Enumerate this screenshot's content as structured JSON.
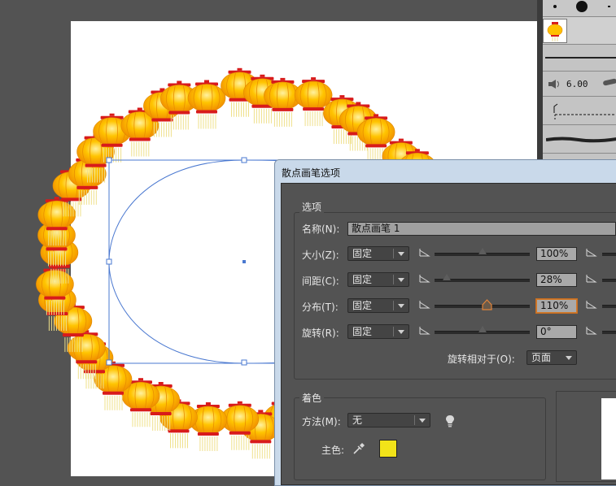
{
  "dialog": {
    "title": "散点画笔选项",
    "options_group": {
      "title": "选项",
      "name_label": "名称(N):",
      "name_value": "散点画笔 1",
      "rows": [
        {
          "label": "大小(Z):",
          "mode": "固定",
          "value": "100%",
          "slider_fraction": 0.5
        },
        {
          "label": "间距(C):",
          "mode": "固定",
          "value": "28%",
          "slider_fraction": 0.12
        },
        {
          "label": "分布(T):",
          "mode": "固定",
          "value": "110%",
          "slider_fraction": 0.55
        },
        {
          "label": "旋转(R):",
          "mode": "固定",
          "value": "0°",
          "slider_fraction": 0.5
        }
      ],
      "rotation_relative_label": "旋转相对于(O):",
      "rotation_relative_value": "页面"
    },
    "colorization_group": {
      "title": "着色",
      "method_label": "方法(M):",
      "method_value": "无",
      "key_color_label": "主色:",
      "key_color": "#f2e319"
    }
  },
  "brush_panel": {
    "size_readout": "6.00"
  },
  "colors": {
    "workspace": "#535353",
    "selection": "#4a78d0",
    "lantern_body": "#ffc000",
    "lantern_cap": "#e02020",
    "tassel": "#f3e79a",
    "focus": "#d07a2a"
  }
}
